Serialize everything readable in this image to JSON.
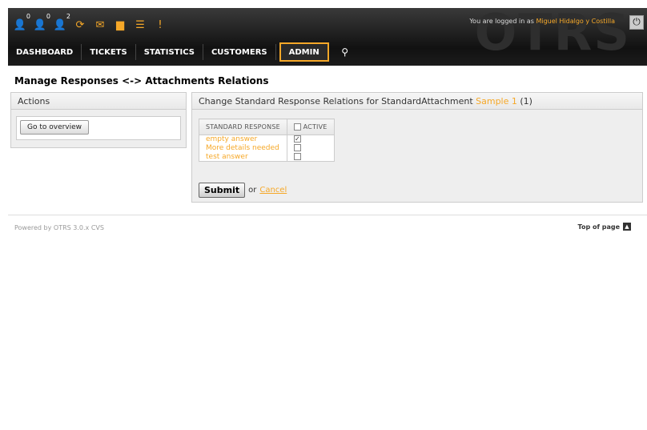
{
  "header": {
    "logo_text": "OTRS",
    "logged_in_prefix": "You are logged in as",
    "user_name": "Miguel Hidalgo y Costilla",
    "toolbar": [
      {
        "icon": "locked-tickets-icon",
        "glyph": "👤",
        "count": "0"
      },
      {
        "icon": "watched-tickets-icon",
        "glyph": "👤",
        "count": "0"
      },
      {
        "icon": "responsible-tickets-icon",
        "glyph": "👤",
        "count": "2"
      },
      {
        "icon": "refresh-icon",
        "glyph": "⟳",
        "count": ""
      },
      {
        "icon": "mail-icon",
        "glyph": "✉",
        "count": ""
      },
      {
        "icon": "folder-icon",
        "glyph": "▆",
        "count": ""
      },
      {
        "icon": "list-icon",
        "glyph": "☰",
        "count": ""
      },
      {
        "icon": "alert-icon",
        "glyph": "!",
        "count": ""
      }
    ],
    "nav": [
      "DASHBOARD",
      "TICKETS",
      "STATISTICS",
      "CUSTOMERS",
      "ADMIN"
    ],
    "active_nav": "ADMIN"
  },
  "page": {
    "title": "Manage Responses <-> Attachments Relations"
  },
  "actions": {
    "header": "Actions",
    "overview_button": "Go to overview"
  },
  "main": {
    "header_prefix": "Change Standard Response Relations for StandardAttachment",
    "attachment_name": "Sample 1",
    "header_suffix": "(1)",
    "col_response": "STANDARD RESPONSE",
    "col_active": "ACTIVE",
    "rows": [
      {
        "name": "empty answer",
        "checked": true
      },
      {
        "name": "More details needed",
        "checked": false
      },
      {
        "name": "test answer",
        "checked": false
      }
    ],
    "submit_label": "Submit",
    "or_label": "or",
    "cancel_label": "Cancel"
  },
  "footer": {
    "powered_by": "Powered by OTRS 3.0.x CVS",
    "top_of_page": "Top of page"
  },
  "colors": {
    "accent": "#f6a828",
    "header_bg": "#111111"
  }
}
